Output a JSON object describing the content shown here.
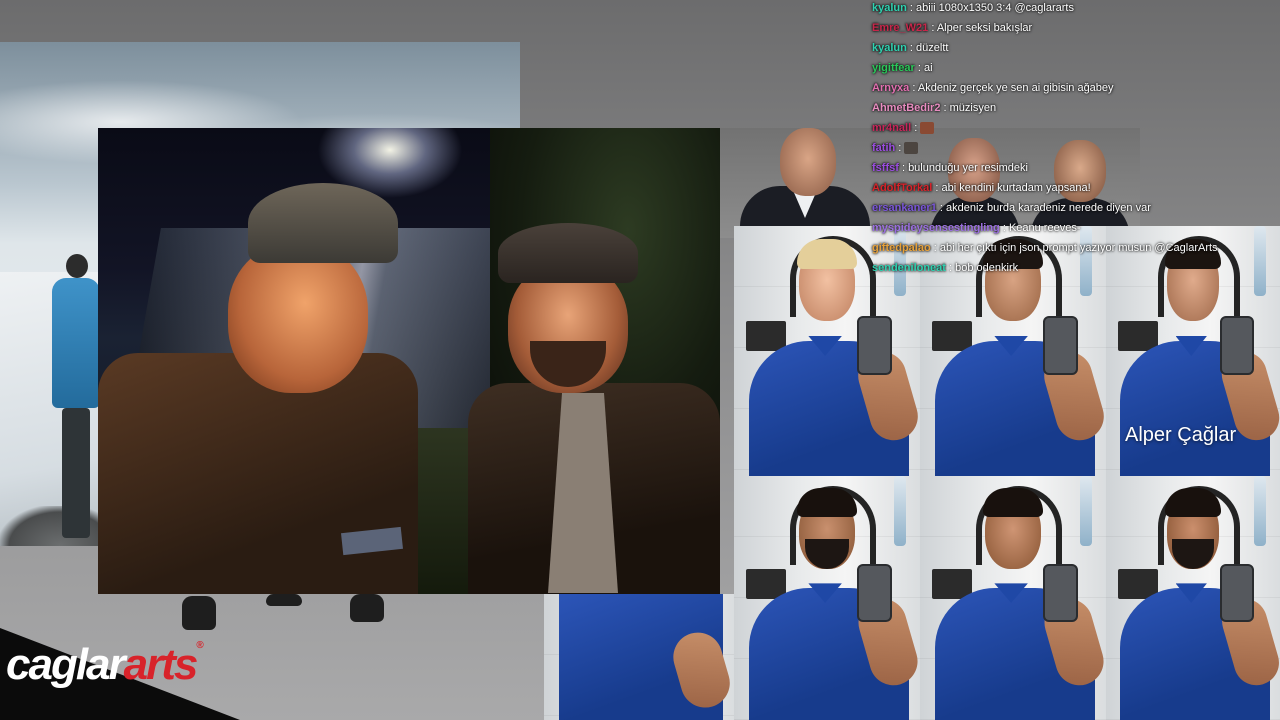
{
  "logo": {
    "part1": "caglar",
    "part2": "arts",
    "mark": "®"
  },
  "watermark": "Alper Çağlar",
  "chat": [
    {
      "user": "kyalun",
      "color": "#2fd1b0",
      "text": "abiii 1080x1350 3:4 @caglararts"
    },
    {
      "user": "Emre_W21",
      "color": "#c8264a",
      "text": "Alper seksi bakışlar"
    },
    {
      "user": "kyalun",
      "color": "#2fd1b0",
      "text": "düzeltt"
    },
    {
      "user": "yigitfear",
      "color": "#29c759",
      "text": "ai"
    },
    {
      "user": "Arnyxa",
      "color": "#e26fb0",
      "text": "Akdeniz gerçek ye sen ai gibisin ağabey"
    },
    {
      "user": "AhmetBedir2",
      "color": "#e88cc0",
      "text": "müzisyen"
    },
    {
      "user": "mr4nall",
      "color": "#c9255a",
      "text": "",
      "emote": "#8a4a33"
    },
    {
      "user": "fatih",
      "color": "#9b4de0",
      "text": "",
      "emote": "#4c4540"
    },
    {
      "user": "fsffsf",
      "color": "#9b4de0",
      "text": "bulunduğu yer resimdeki"
    },
    {
      "user": "AdolfTorkal",
      "color": "#d8232a",
      "text": "abi kendini kurtadam yapsana!"
    },
    {
      "user": "ersankaner1",
      "color": "#7a56d8",
      "text": "akdeniz burda karadeniz nerede diyen var"
    },
    {
      "user": "myspideysensestingling",
      "color": "#9b6fe0",
      "text": "Keanu reeves-"
    },
    {
      "user": "giftedpalao",
      "color": "#e6a13b",
      "text": "abi her çıktı için json prompt yazıyor musun @CaglarArts"
    },
    {
      "user": "sendeniloneat",
      "color": "#2fd1b0",
      "text": "bob odenkirk"
    }
  ]
}
